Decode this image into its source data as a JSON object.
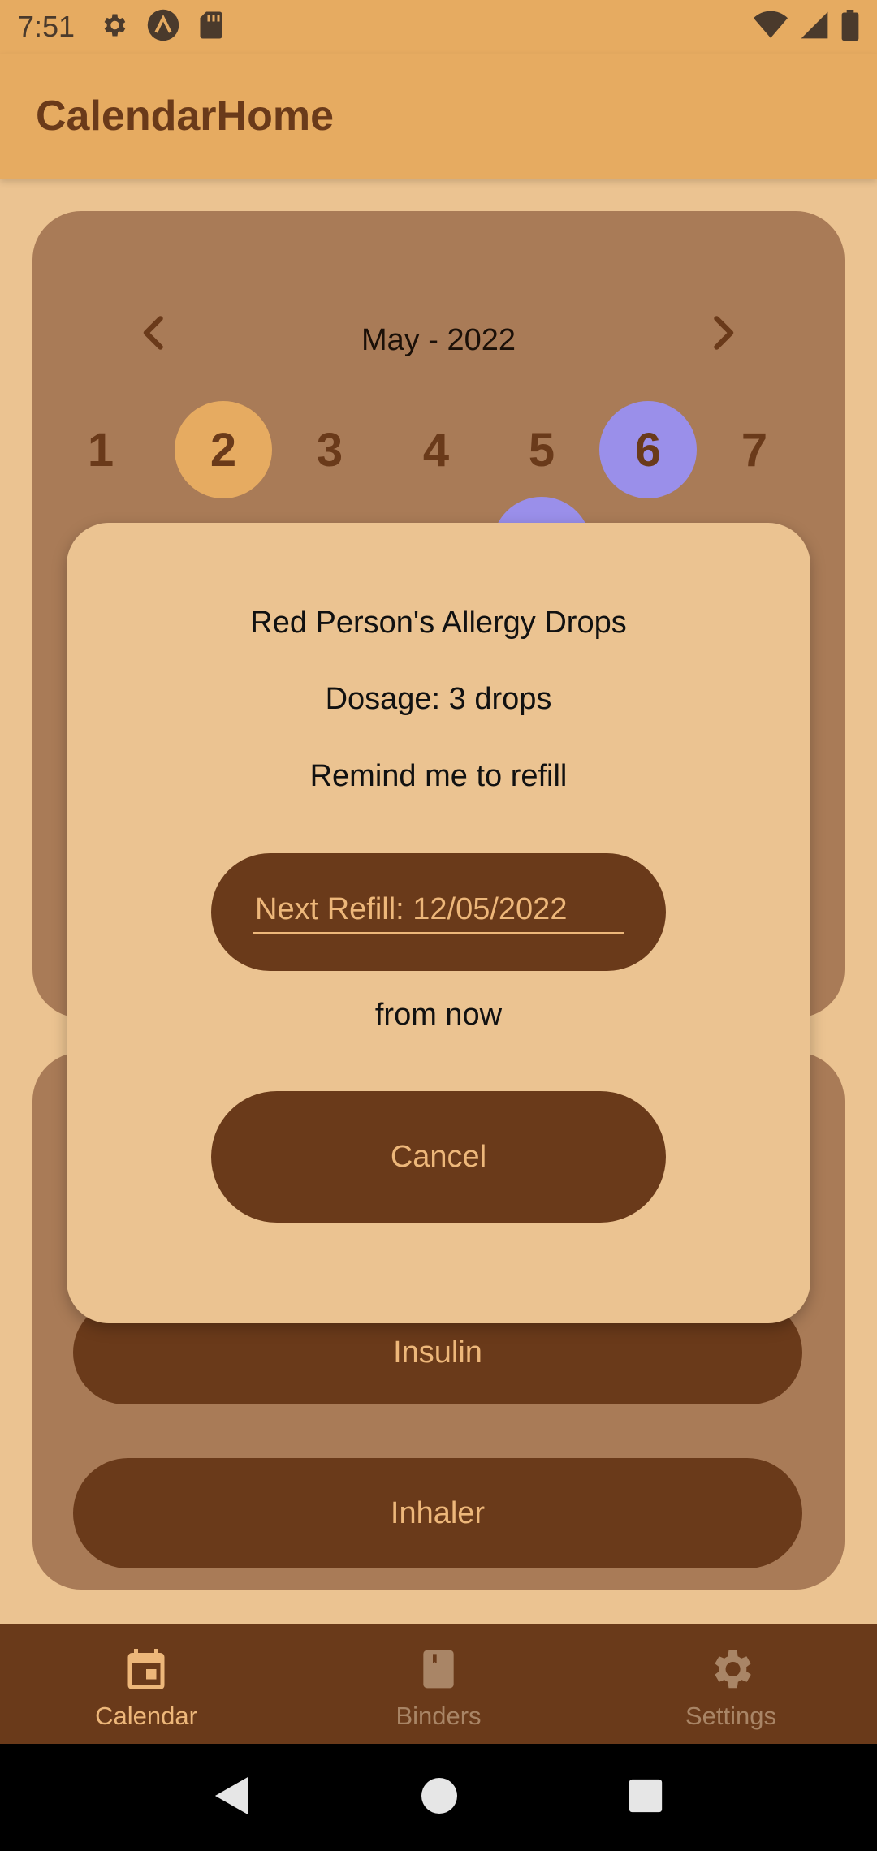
{
  "status_bar": {
    "time": "7:51",
    "left_icons": [
      "gear-icon",
      "app-launcher-icon",
      "sd-card-icon"
    ],
    "right_icons": [
      "wifi-icon",
      "cell-signal-icon",
      "battery-icon"
    ]
  },
  "app_bar": {
    "title": "CalendarHome"
  },
  "calendar": {
    "month_label": "May - 2022",
    "days": [
      {
        "label": "1",
        "state": "normal"
      },
      {
        "label": "2",
        "state": "selected"
      },
      {
        "label": "3",
        "state": "normal"
      },
      {
        "label": "4",
        "state": "normal"
      },
      {
        "label": "5",
        "state": "normal"
      },
      {
        "label": "6",
        "state": "marked"
      },
      {
        "label": "7",
        "state": "normal"
      }
    ]
  },
  "list": {
    "insulin_label": "Insulin",
    "inhaler_label": "Inhaler"
  },
  "dialog": {
    "title": "Red Person's Allergy Drops",
    "dosage": "Dosage: 3 drops",
    "remind": "Remind me to refill",
    "refill_placeholder": "Next Refill: 12/05/2022",
    "from_now": "from now",
    "cancel_label": "Cancel"
  },
  "bottom_nav": {
    "items": [
      {
        "label": "Calendar",
        "icon": "calendar-icon",
        "active": true
      },
      {
        "label": "Binders",
        "icon": "binder-icon",
        "active": false
      },
      {
        "label": "Settings",
        "icon": "settings-icon",
        "active": false
      }
    ]
  },
  "colors": {
    "background": "#EBC391",
    "app_bar": "#E6AB61",
    "card": "#A97B57",
    "primary_brown": "#6A3A1A",
    "accent_text": "#EDB77A",
    "marked_day": "#9A8FEA"
  }
}
